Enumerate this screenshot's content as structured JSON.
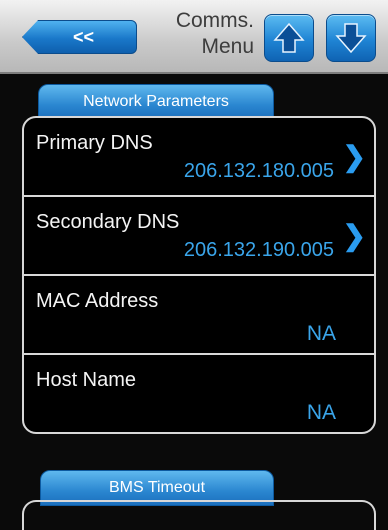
{
  "header": {
    "back_label": "<<",
    "title_line1": "Comms.",
    "title_line2": "Menu"
  },
  "tabs": {
    "network": "Network Parameters",
    "bms": "BMS Timeout"
  },
  "rows": [
    {
      "label": "Primary DNS",
      "value": "206.132.180.005",
      "has_chevron": true
    },
    {
      "label": "Secondary DNS",
      "value": "206.132.190.005",
      "has_chevron": true
    },
    {
      "label": "MAC Address",
      "value": "NA",
      "has_chevron": false
    },
    {
      "label": "Host Name",
      "value": "NA",
      "has_chevron": false
    }
  ],
  "icons": {
    "chevron": "chevron-right-icon",
    "up": "arrow-up-icon",
    "down": "arrow-down-icon"
  },
  "colors": {
    "accent": "#2a9cf0",
    "value_text": "#3aa5ea",
    "label_text": "#f4f4f4",
    "background": "#0a0a0a"
  }
}
